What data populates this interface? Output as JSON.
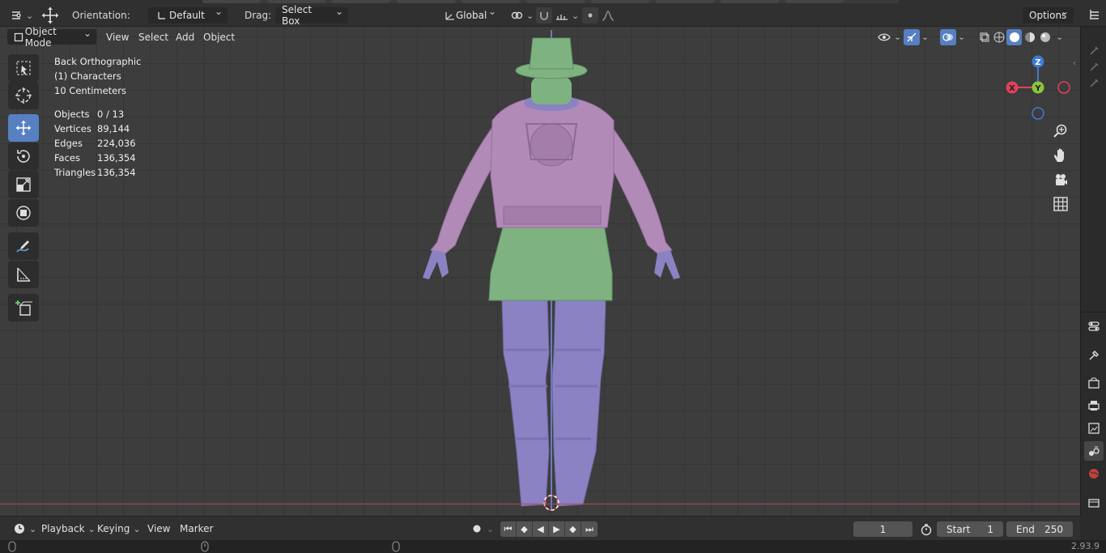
{
  "header": {
    "orientation_label": "Orientation:",
    "orientation_value": "Default",
    "drag_label": "Drag:",
    "drag_value": "Select Box",
    "transform_space": "Global",
    "options_label": "Options"
  },
  "viewport_header": {
    "mode": "Object Mode",
    "menus": [
      "View",
      "Select",
      "Add",
      "Object"
    ]
  },
  "overlay": {
    "view_name": "Back Orthographic",
    "collection": "(1) Characters",
    "scale": "10 Centimeters",
    "stats": [
      {
        "label": "Objects",
        "value": "0 / 13"
      },
      {
        "label": "Vertices",
        "value": "89,144"
      },
      {
        "label": "Edges",
        "value": "224,036"
      },
      {
        "label": "Faces",
        "value": "136,354"
      },
      {
        "label": "Triangles",
        "value": "136,354"
      }
    ]
  },
  "gizmo": {
    "z": "Z",
    "y": "Y",
    "x": "X"
  },
  "timeline": {
    "menus": [
      "Playback",
      "Keying",
      "View",
      "Marker"
    ],
    "current_frame": "1",
    "start_label": "Start",
    "start_value": "1",
    "end_label": "End",
    "end_value": "250"
  },
  "status": {
    "version": "2.93.9"
  },
  "colors": {
    "accent": "#5680c2",
    "axis_x": "#e0425a",
    "axis_y": "#8bc53f",
    "axis_z": "#3e7bd1",
    "mesh_purple": "#b28ab8",
    "mesh_green": "#7fb281",
    "mesh_lavender": "#8a82c2"
  }
}
